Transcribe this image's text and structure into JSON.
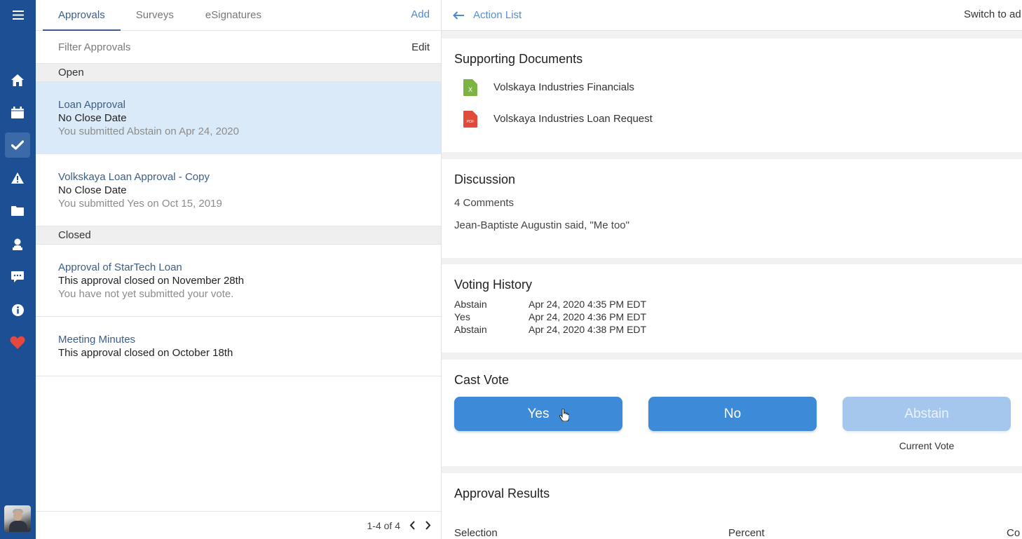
{
  "nav": {
    "menu_icon": "hamburger-menu-icon",
    "items": [
      {
        "name": "home",
        "icon": "home-icon",
        "active": false
      },
      {
        "name": "calendar",
        "icon": "calendar-icon",
        "active": false
      },
      {
        "name": "approvals",
        "icon": "checkmark-icon",
        "active": true
      },
      {
        "name": "alerts",
        "icon": "warning-icon",
        "active": false
      },
      {
        "name": "documents",
        "icon": "folder-icon",
        "active": false
      },
      {
        "name": "people",
        "icon": "person-icon",
        "active": false
      },
      {
        "name": "messages",
        "icon": "chat-icon",
        "active": false
      },
      {
        "name": "info",
        "icon": "info-icon",
        "active": false
      },
      {
        "name": "favorites",
        "icon": "heart-icon",
        "active": false
      }
    ],
    "heart_color": "#e5483e",
    "rail_color": "#1c4f93"
  },
  "list_panel": {
    "tabs": [
      {
        "label": "Approvals",
        "active": true
      },
      {
        "label": "Surveys",
        "active": false
      },
      {
        "label": "eSignatures",
        "active": false
      }
    ],
    "add_label": "Add",
    "filter": {
      "placeholder": "Filter Approvals",
      "value": ""
    },
    "edit_label": "Edit",
    "sections": [
      {
        "header": "Open",
        "items": [
          {
            "title": "Loan Approval",
            "subtitle": "No Close Date",
            "meta": "You submitted Abstain on Apr 24, 2020",
            "selected": true
          },
          {
            "title": "Volkskaya Loan Approval - Copy",
            "subtitle": "No Close Date",
            "meta": "You submitted Yes on Oct 15, 2019",
            "selected": false
          }
        ]
      },
      {
        "header": "Closed",
        "items": [
          {
            "title": "Approval of StarTech Loan",
            "subtitle": "This approval closed on November 28th",
            "meta": "You have not yet submitted your vote.",
            "selected": false
          },
          {
            "title": "Meeting Minutes",
            "subtitle": "This approval closed on October 18th",
            "meta": "",
            "selected": false
          }
        ]
      }
    ],
    "pagination": {
      "range": "1-4 of 4",
      "prev_icon": "chevron-left-icon",
      "next_icon": "chevron-right-icon"
    }
  },
  "detail": {
    "back_label": "Action List",
    "switch_label": "Switch to ad",
    "supporting_documents": {
      "title": "Supporting Documents",
      "items": [
        {
          "name": "Volskaya Industries Financials",
          "type": "excel",
          "icon": "excel-file-icon",
          "badge": "X",
          "color": "#7cb342"
        },
        {
          "name": "Volskaya Industries Loan Request",
          "type": "pdf",
          "icon": "pdf-file-icon",
          "badge": "PDF",
          "color": "#e04b3a"
        }
      ]
    },
    "discussion": {
      "title": "Discussion",
      "count_label": "4 Comments",
      "latest_comment": "Jean-Baptiste Augustin said, \"Me too\""
    },
    "voting_history": {
      "title": "Voting History",
      "rows": [
        {
          "selection": "Abstain",
          "timestamp": "Apr 24, 2020 4:35 PM EDT"
        },
        {
          "selection": "Yes",
          "timestamp": "Apr 24, 2020 4:36 PM EDT"
        },
        {
          "selection": "Abstain",
          "timestamp": "Apr 24, 2020 4:38 PM EDT"
        }
      ]
    },
    "cast_vote": {
      "title": "Cast Vote",
      "options": [
        {
          "label": "Yes",
          "current": false
        },
        {
          "label": "No",
          "current": false
        },
        {
          "label": "Abstain",
          "current": true
        }
      ],
      "current_vote_label": "Current Vote",
      "button_color": "#3d8ad8",
      "current_button_color": "#a5c7ee"
    },
    "approval_results": {
      "title": "Approval Results",
      "columns": [
        "Selection",
        "Percent",
        "Co"
      ]
    }
  }
}
